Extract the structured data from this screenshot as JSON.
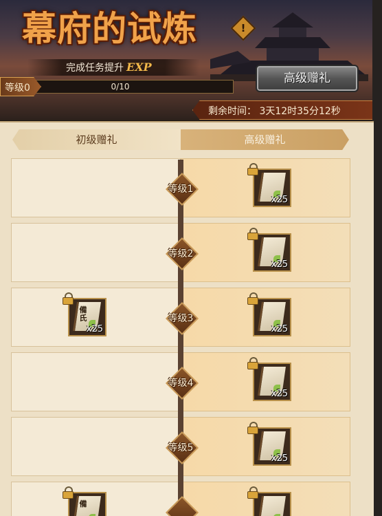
{
  "header": {
    "title": "幕府的试炼",
    "subtitle": "完成任务提升",
    "subtitle_highlight": "EXP",
    "level_label": "等级0",
    "exp_text": "0/10",
    "exp_progress": 0,
    "premium_button": "高级赠礼",
    "timer": "剩余时间：  3天12时35分12秒",
    "info_symbol": "!"
  },
  "tabs": {
    "basic": "初级赠礼",
    "premium": "高级赠礼"
  },
  "rows": [
    {
      "level": "等级1",
      "basic_item": null,
      "premium_qty": "x25"
    },
    {
      "level": "等级2",
      "basic_item": null,
      "premium_qty": "x25"
    },
    {
      "level": "等级3",
      "basic_item": {
        "badge": "備氏",
        "qty": "x25"
      },
      "premium_qty": "x25"
    },
    {
      "level": "等级4",
      "basic_item": null,
      "premium_qty": "x25"
    },
    {
      "level": "等级5",
      "basic_item": null,
      "premium_qty": "x25"
    },
    {
      "level": "",
      "basic_item": {
        "badge": "備",
        "qty": ""
      },
      "premium_qty": ""
    }
  ],
  "colors": {
    "accent": "#f0a24a",
    "panel": "#ede0c6",
    "premium_column": "#f6d9a8"
  }
}
